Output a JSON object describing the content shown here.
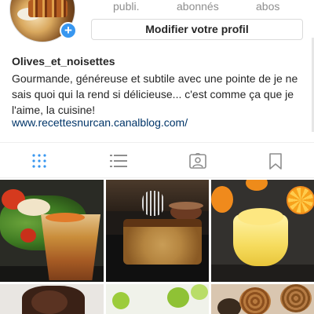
{
  "profile": {
    "stats": [
      {
        "label": "publi."
      },
      {
        "label": "abonnés"
      },
      {
        "label": "abos"
      }
    ],
    "edit_profile_label": "Modifier votre profil",
    "username": "Olives_et_noisettes",
    "bio": "Gourmande, généreuse et subtile avec une pointe de je ne sais quoi qui la rend si délicieuse... c'est comme ça que je l'aime, la cuisine!",
    "website": "www.recettesnurcan.canalblog.com/"
  },
  "tabs": [
    {
      "icon": "grid-icon",
      "active": true
    },
    {
      "icon": "list-icon",
      "active": false
    },
    {
      "icon": "tagged-photos-icon",
      "active": false
    },
    {
      "icon": "bookmark-icon",
      "active": false
    }
  ],
  "colors": {
    "accent": "#3897f0",
    "link": "#003569",
    "text": "#262626",
    "muted": "#8e8e8e"
  }
}
